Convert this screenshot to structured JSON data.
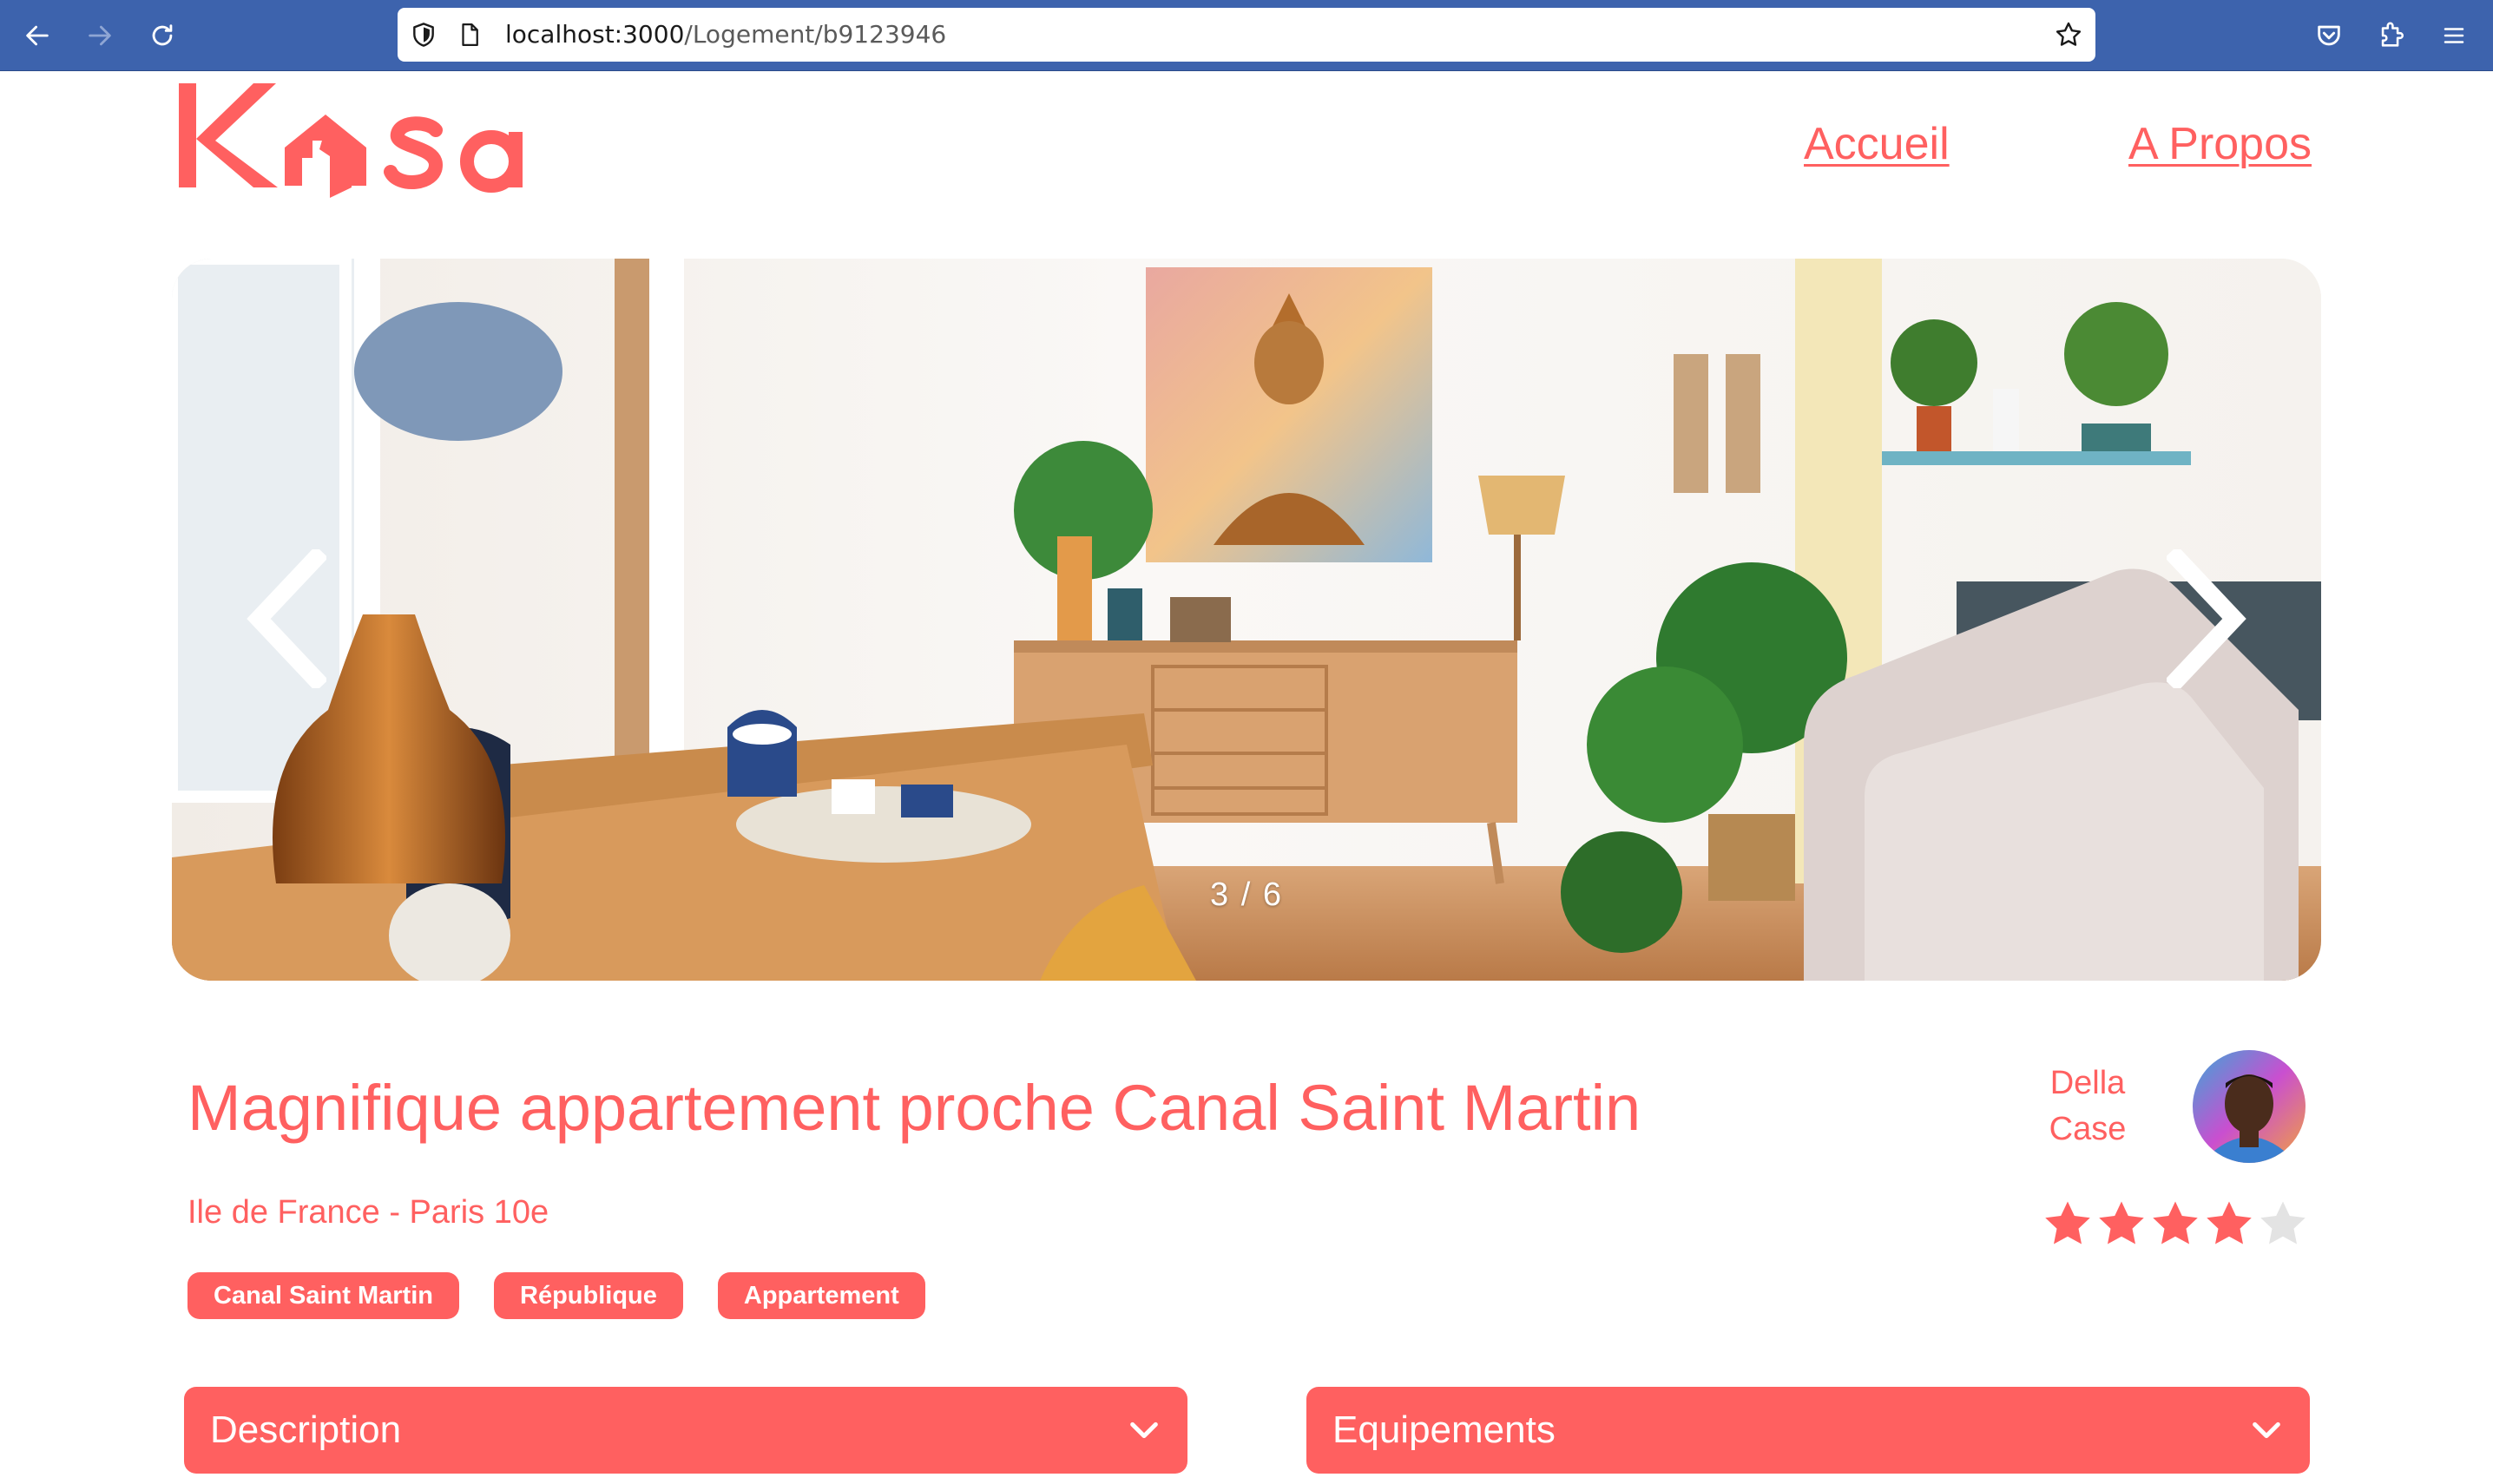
{
  "browser": {
    "url_host": "localhost:3000",
    "url_path": "/Logement/b9123946",
    "back_icon": "arrow-left-icon",
    "forward_icon": "arrow-right-icon",
    "reload_icon": "reload-icon",
    "bookmark_icon": "star-outline-icon",
    "pocket_icon": "pocket-icon",
    "extensions_icon": "puzzle-icon",
    "menu_icon": "hamburger-menu-icon"
  },
  "header": {
    "logo_text": "Kasa",
    "nav": [
      {
        "label": "Accueil"
      },
      {
        "label": "A Propos"
      }
    ]
  },
  "carousel": {
    "counter": "3 / 6",
    "current": 3,
    "total": 6,
    "prev_icon": "chevron-left-icon",
    "next_icon": "chevron-right-icon"
  },
  "listing": {
    "title": "Magnifique appartement proche Canal Saint Martin",
    "location": "Ile de France - Paris 10e",
    "tags": [
      "Canal Saint Martin",
      "République",
      "Appartement"
    ],
    "host": {
      "first_name": "Della",
      "last_name": "Case"
    },
    "rating": 4,
    "rating_max": 5
  },
  "collapses": [
    {
      "label": "Description",
      "icon": "chevron-down-icon"
    },
    {
      "label": "Equipements",
      "icon": "chevron-down-icon"
    }
  ],
  "colors": {
    "accent": "#ff6060",
    "star_empty": "#e3e3e3",
    "chrome": "#3d63ad"
  }
}
